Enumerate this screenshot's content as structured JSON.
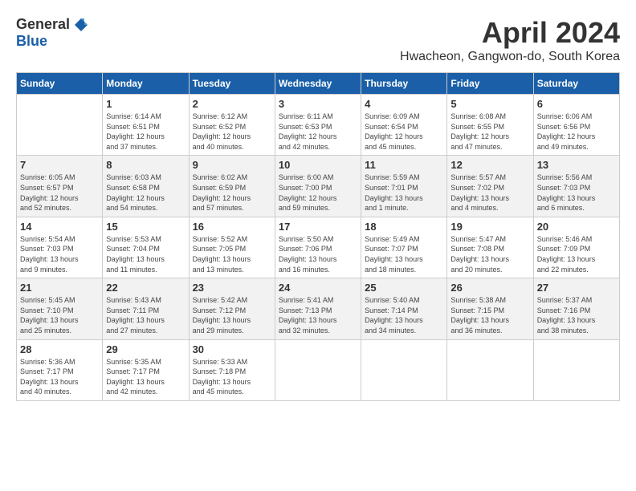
{
  "header": {
    "logo_general": "General",
    "logo_blue": "Blue",
    "title": "April 2024",
    "location": "Hwacheon, Gangwon-do, South Korea"
  },
  "days_of_week": [
    "Sunday",
    "Monday",
    "Tuesday",
    "Wednesday",
    "Thursday",
    "Friday",
    "Saturday"
  ],
  "weeks": [
    [
      {
        "day": "",
        "info": ""
      },
      {
        "day": "1",
        "info": "Sunrise: 6:14 AM\nSunset: 6:51 PM\nDaylight: 12 hours\nand 37 minutes."
      },
      {
        "day": "2",
        "info": "Sunrise: 6:12 AM\nSunset: 6:52 PM\nDaylight: 12 hours\nand 40 minutes."
      },
      {
        "day": "3",
        "info": "Sunrise: 6:11 AM\nSunset: 6:53 PM\nDaylight: 12 hours\nand 42 minutes."
      },
      {
        "day": "4",
        "info": "Sunrise: 6:09 AM\nSunset: 6:54 PM\nDaylight: 12 hours\nand 45 minutes."
      },
      {
        "day": "5",
        "info": "Sunrise: 6:08 AM\nSunset: 6:55 PM\nDaylight: 12 hours\nand 47 minutes."
      },
      {
        "day": "6",
        "info": "Sunrise: 6:06 AM\nSunset: 6:56 PM\nDaylight: 12 hours\nand 49 minutes."
      }
    ],
    [
      {
        "day": "7",
        "info": "Sunrise: 6:05 AM\nSunset: 6:57 PM\nDaylight: 12 hours\nand 52 minutes."
      },
      {
        "day": "8",
        "info": "Sunrise: 6:03 AM\nSunset: 6:58 PM\nDaylight: 12 hours\nand 54 minutes."
      },
      {
        "day": "9",
        "info": "Sunrise: 6:02 AM\nSunset: 6:59 PM\nDaylight: 12 hours\nand 57 minutes."
      },
      {
        "day": "10",
        "info": "Sunrise: 6:00 AM\nSunset: 7:00 PM\nDaylight: 12 hours\nand 59 minutes."
      },
      {
        "day": "11",
        "info": "Sunrise: 5:59 AM\nSunset: 7:01 PM\nDaylight: 13 hours\nand 1 minute."
      },
      {
        "day": "12",
        "info": "Sunrise: 5:57 AM\nSunset: 7:02 PM\nDaylight: 13 hours\nand 4 minutes."
      },
      {
        "day": "13",
        "info": "Sunrise: 5:56 AM\nSunset: 7:03 PM\nDaylight: 13 hours\nand 6 minutes."
      }
    ],
    [
      {
        "day": "14",
        "info": "Sunrise: 5:54 AM\nSunset: 7:03 PM\nDaylight: 13 hours\nand 9 minutes."
      },
      {
        "day": "15",
        "info": "Sunrise: 5:53 AM\nSunset: 7:04 PM\nDaylight: 13 hours\nand 11 minutes."
      },
      {
        "day": "16",
        "info": "Sunrise: 5:52 AM\nSunset: 7:05 PM\nDaylight: 13 hours\nand 13 minutes."
      },
      {
        "day": "17",
        "info": "Sunrise: 5:50 AM\nSunset: 7:06 PM\nDaylight: 13 hours\nand 16 minutes."
      },
      {
        "day": "18",
        "info": "Sunrise: 5:49 AM\nSunset: 7:07 PM\nDaylight: 13 hours\nand 18 minutes."
      },
      {
        "day": "19",
        "info": "Sunrise: 5:47 AM\nSunset: 7:08 PM\nDaylight: 13 hours\nand 20 minutes."
      },
      {
        "day": "20",
        "info": "Sunrise: 5:46 AM\nSunset: 7:09 PM\nDaylight: 13 hours\nand 22 minutes."
      }
    ],
    [
      {
        "day": "21",
        "info": "Sunrise: 5:45 AM\nSunset: 7:10 PM\nDaylight: 13 hours\nand 25 minutes."
      },
      {
        "day": "22",
        "info": "Sunrise: 5:43 AM\nSunset: 7:11 PM\nDaylight: 13 hours\nand 27 minutes."
      },
      {
        "day": "23",
        "info": "Sunrise: 5:42 AM\nSunset: 7:12 PM\nDaylight: 13 hours\nand 29 minutes."
      },
      {
        "day": "24",
        "info": "Sunrise: 5:41 AM\nSunset: 7:13 PM\nDaylight: 13 hours\nand 32 minutes."
      },
      {
        "day": "25",
        "info": "Sunrise: 5:40 AM\nSunset: 7:14 PM\nDaylight: 13 hours\nand 34 minutes."
      },
      {
        "day": "26",
        "info": "Sunrise: 5:38 AM\nSunset: 7:15 PM\nDaylight: 13 hours\nand 36 minutes."
      },
      {
        "day": "27",
        "info": "Sunrise: 5:37 AM\nSunset: 7:16 PM\nDaylight: 13 hours\nand 38 minutes."
      }
    ],
    [
      {
        "day": "28",
        "info": "Sunrise: 5:36 AM\nSunset: 7:17 PM\nDaylight: 13 hours\nand 40 minutes."
      },
      {
        "day": "29",
        "info": "Sunrise: 5:35 AM\nSunset: 7:17 PM\nDaylight: 13 hours\nand 42 minutes."
      },
      {
        "day": "30",
        "info": "Sunrise: 5:33 AM\nSunset: 7:18 PM\nDaylight: 13 hours\nand 45 minutes."
      },
      {
        "day": "",
        "info": ""
      },
      {
        "day": "",
        "info": ""
      },
      {
        "day": "",
        "info": ""
      },
      {
        "day": "",
        "info": ""
      }
    ]
  ]
}
